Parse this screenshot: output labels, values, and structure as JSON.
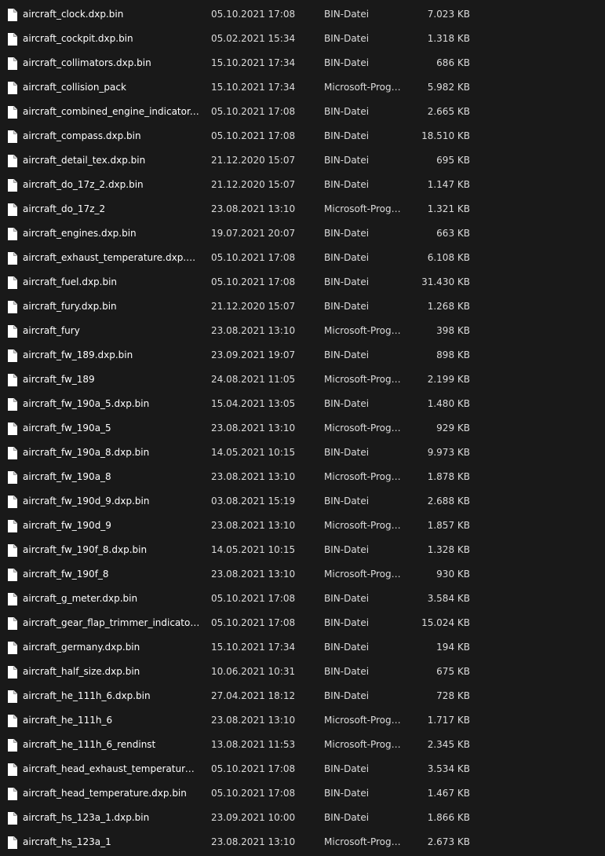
{
  "icons": {
    "file": "file-icon"
  },
  "files": [
    {
      "name": "aircraft_clock.dxp.bin",
      "date": "05.10.2021 17:08",
      "type": "BIN-Datei",
      "size": "7.023 KB"
    },
    {
      "name": "aircraft_cockpit.dxp.bin",
      "date": "05.02.2021 15:34",
      "type": "BIN-Datei",
      "size": "1.318 KB"
    },
    {
      "name": "aircraft_collimators.dxp.bin",
      "date": "15.10.2021 17:34",
      "type": "BIN-Datei",
      "size": "686 KB"
    },
    {
      "name": "aircraft_collision_pack",
      "date": "15.10.2021 17:34",
      "type": "Microsoft-Progra...",
      "size": "5.982 KB"
    },
    {
      "name": "aircraft_combined_engine_indicator.dxp....",
      "date": "05.10.2021 17:08",
      "type": "BIN-Datei",
      "size": "2.665 KB"
    },
    {
      "name": "aircraft_compass.dxp.bin",
      "date": "05.10.2021 17:08",
      "type": "BIN-Datei",
      "size": "18.510 KB"
    },
    {
      "name": "aircraft_detail_tex.dxp.bin",
      "date": "21.12.2020 15:07",
      "type": "BIN-Datei",
      "size": "695 KB"
    },
    {
      "name": "aircraft_do_17z_2.dxp.bin",
      "date": "21.12.2020 15:07",
      "type": "BIN-Datei",
      "size": "1.147 KB"
    },
    {
      "name": "aircraft_do_17z_2",
      "date": "23.08.2021 13:10",
      "type": "Microsoft-Progra...",
      "size": "1.321 KB"
    },
    {
      "name": "aircraft_engines.dxp.bin",
      "date": "19.07.2021 20:07",
      "type": "BIN-Datei",
      "size": "663 KB"
    },
    {
      "name": "aircraft_exhaust_temperature.dxp.bin",
      "date": "05.10.2021 17:08",
      "type": "BIN-Datei",
      "size": "6.108 KB"
    },
    {
      "name": "aircraft_fuel.dxp.bin",
      "date": "05.10.2021 17:08",
      "type": "BIN-Datei",
      "size": "31.430 KB"
    },
    {
      "name": "aircraft_fury.dxp.bin",
      "date": "21.12.2020 15:07",
      "type": "BIN-Datei",
      "size": "1.268 KB"
    },
    {
      "name": "aircraft_fury",
      "date": "23.08.2021 13:10",
      "type": "Microsoft-Progra...",
      "size": "398 KB"
    },
    {
      "name": "aircraft_fw_189.dxp.bin",
      "date": "23.09.2021 19:07",
      "type": "BIN-Datei",
      "size": "898 KB"
    },
    {
      "name": "aircraft_fw_189",
      "date": "24.08.2021 11:05",
      "type": "Microsoft-Progra...",
      "size": "2.199 KB"
    },
    {
      "name": "aircraft_fw_190a_5.dxp.bin",
      "date": "15.04.2021 13:05",
      "type": "BIN-Datei",
      "size": "1.480 KB"
    },
    {
      "name": "aircraft_fw_190a_5",
      "date": "23.08.2021 13:10",
      "type": "Microsoft-Progra...",
      "size": "929 KB"
    },
    {
      "name": "aircraft_fw_190a_8.dxp.bin",
      "date": "14.05.2021 10:15",
      "type": "BIN-Datei",
      "size": "9.973 KB"
    },
    {
      "name": "aircraft_fw_190a_8",
      "date": "23.08.2021 13:10",
      "type": "Microsoft-Progra...",
      "size": "1.878 KB"
    },
    {
      "name": "aircraft_fw_190d_9.dxp.bin",
      "date": "03.08.2021 15:19",
      "type": "BIN-Datei",
      "size": "2.688 KB"
    },
    {
      "name": "aircraft_fw_190d_9",
      "date": "23.08.2021 13:10",
      "type": "Microsoft-Progra...",
      "size": "1.857 KB"
    },
    {
      "name": "aircraft_fw_190f_8.dxp.bin",
      "date": "14.05.2021 10:15",
      "type": "BIN-Datei",
      "size": "1.328 KB"
    },
    {
      "name": "aircraft_fw_190f_8",
      "date": "23.08.2021 13:10",
      "type": "Microsoft-Progra...",
      "size": "930 KB"
    },
    {
      "name": "aircraft_g_meter.dxp.bin",
      "date": "05.10.2021 17:08",
      "type": "BIN-Datei",
      "size": "3.584 KB"
    },
    {
      "name": "aircraft_gear_flap_trimmer_indicator.dxp....",
      "date": "05.10.2021 17:08",
      "type": "BIN-Datei",
      "size": "15.024 KB"
    },
    {
      "name": "aircraft_germany.dxp.bin",
      "date": "15.10.2021 17:34",
      "type": "BIN-Datei",
      "size": "194 KB"
    },
    {
      "name": "aircraft_half_size.dxp.bin",
      "date": "10.06.2021 10:31",
      "type": "BIN-Datei",
      "size": "675 KB"
    },
    {
      "name": "aircraft_he_111h_6.dxp.bin",
      "date": "27.04.2021 18:12",
      "type": "BIN-Datei",
      "size": "728 KB"
    },
    {
      "name": "aircraft_he_111h_6",
      "date": "23.08.2021 13:10",
      "type": "Microsoft-Progra...",
      "size": "1.717 KB"
    },
    {
      "name": "aircraft_he_111h_6_rendinst",
      "date": "13.08.2021 11:53",
      "type": "Microsoft-Progra...",
      "size": "2.345 KB"
    },
    {
      "name": "aircraft_head_exhaust_temperature.dxp.b...",
      "date": "05.10.2021 17:08",
      "type": "BIN-Datei",
      "size": "3.534 KB"
    },
    {
      "name": "aircraft_head_temperature.dxp.bin",
      "date": "05.10.2021 17:08",
      "type": "BIN-Datei",
      "size": "1.467 KB"
    },
    {
      "name": "aircraft_hs_123a_1.dxp.bin",
      "date": "23.09.2021 10:00",
      "type": "BIN-Datei",
      "size": "1.866 KB"
    },
    {
      "name": "aircraft_hs_123a_1",
      "date": "23.08.2021 13:10",
      "type": "Microsoft-Progra...",
      "size": "2.673 KB"
    }
  ]
}
